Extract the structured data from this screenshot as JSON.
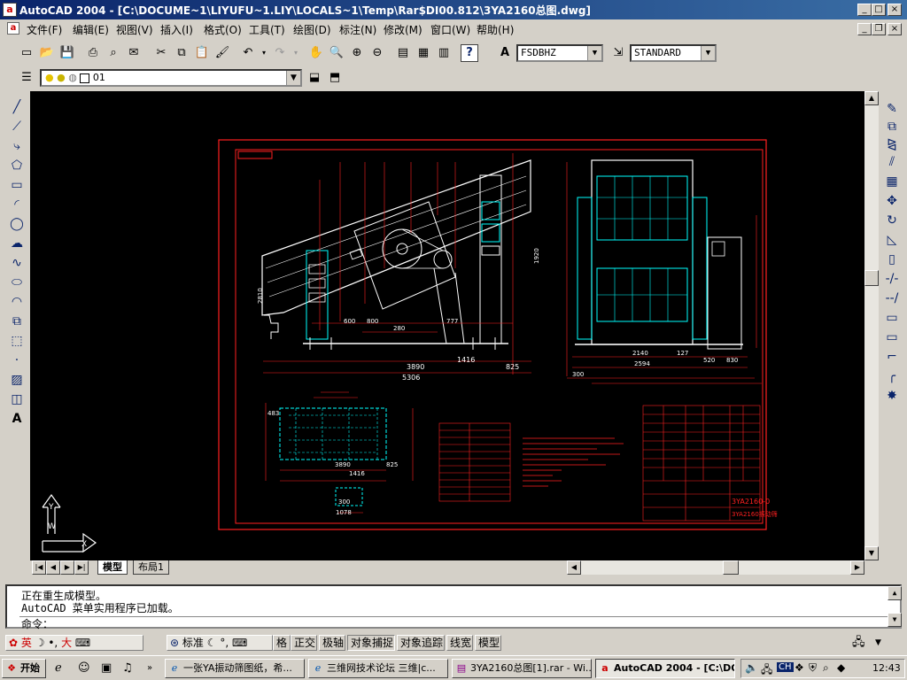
{
  "window": {
    "title": "AutoCAD 2004 - [C:\\DOCUME~1\\LIYUFU~1.LIY\\LOCALS~1\\Temp\\Rar$DI00.812\\3YA2160总图.dwg]",
    "icon": "a"
  },
  "menu": [
    "文件(F)",
    "编辑(E)",
    "视图(V)",
    "插入(I)",
    "格式(O)",
    "工具(T)",
    "绘图(D)",
    "标注(N)",
    "修改(M)",
    "窗口(W)",
    "帮助(H)"
  ],
  "toolbar": {
    "text_style": "FSDBHZ",
    "dim_style": "STANDARD",
    "layer": "01"
  },
  "drawing": {
    "dims_front": [
      "3890",
      "5306",
      "1416",
      "825",
      "2810",
      "1920",
      "600",
      "800",
      "280",
      "777"
    ],
    "dims_side": [
      "2140",
      "2594",
      "300",
      "520",
      "830",
      "127"
    ],
    "dims_plan": [
      "483",
      "1416",
      "3890",
      "825",
      "300",
      "1078"
    ],
    "part_no": "3YA2160-0",
    "part_name": "3YA2160振动筛"
  },
  "tabs": {
    "model": "模型",
    "layout": "布局1"
  },
  "command": {
    "lines": [
      "正在重生成模型。",
      "AutoCAD 菜单实用程序已加载。"
    ],
    "prompt": "命令："
  },
  "status": {
    "ime1": "英",
    "ime1b": "大",
    "ime2": "标准",
    "buttons": [
      "格",
      "正交",
      "极轴",
      "对象捕捉",
      "对象追踪",
      "线宽",
      "模型"
    ]
  },
  "taskbar": {
    "start": "开始",
    "tasks": [
      "一张YA振动筛图纸，希...",
      "三维网技术论坛 三维|c...",
      "3YA2160总图[1].rar - Wi...",
      "AutoCAD 2004 - [C:\\DOC..."
    ],
    "ime": "CH",
    "clock": "12:43"
  }
}
